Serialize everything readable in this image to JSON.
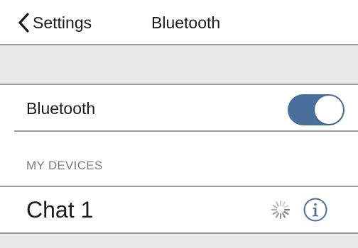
{
  "nav": {
    "back_label": "Settings",
    "title": "Bluetooth",
    "back_icon": "chevron-left-icon"
  },
  "bluetooth_row": {
    "label": "Bluetooth",
    "toggle_on": true,
    "toggle_color": "#4b6f9c"
  },
  "section": {
    "header": "MY DEVICES"
  },
  "devices": [
    {
      "name": "Chat 1",
      "status_icon": "loading-spinner-icon",
      "detail_icon": "info-icon"
    }
  ],
  "colors": {
    "band": "#e8e8e8",
    "divider": "#9a9a9a",
    "accent": "#4b6f9c"
  }
}
